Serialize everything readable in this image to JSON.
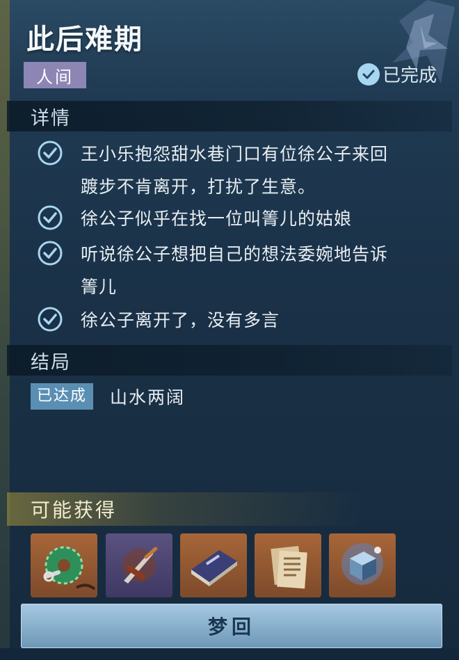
{
  "quest": {
    "title": "此后难期",
    "category": "人间",
    "status": "已完成"
  },
  "details": {
    "header": "详情",
    "items": [
      "王小乐抱怨甜水巷门口有位徐公子来回",
      "踱步不肯离开，打扰了生意。",
      "徐公子似乎在找一位叫箐儿的姑娘",
      "听说徐公子想把自己的想法委婉地告诉",
      "箐儿",
      "徐公子离开了，没有多言"
    ]
  },
  "outcome": {
    "header": "结局",
    "badge": "已达成",
    "text": "山水两阔"
  },
  "rewards": {
    "header": "可能获得",
    "items": [
      {
        "icon": "jade-pendant-icon",
        "rarity_color": "#a76638"
      },
      {
        "icon": "dagger-icon",
        "rarity_color": "#5b527f"
      },
      {
        "icon": "book-icon",
        "rarity_color": "#a76638"
      },
      {
        "icon": "document-icon",
        "rarity_color": "#a76638"
      },
      {
        "icon": "crystal-cube-icon",
        "rarity_color": "#a76638"
      }
    ]
  },
  "action": {
    "button_label": "梦回"
  },
  "colors": {
    "accent": "#a8d6f1",
    "category_tag": "#8d86b5",
    "outcome_badge": "#5a8fb3",
    "button": "#86aecb"
  }
}
